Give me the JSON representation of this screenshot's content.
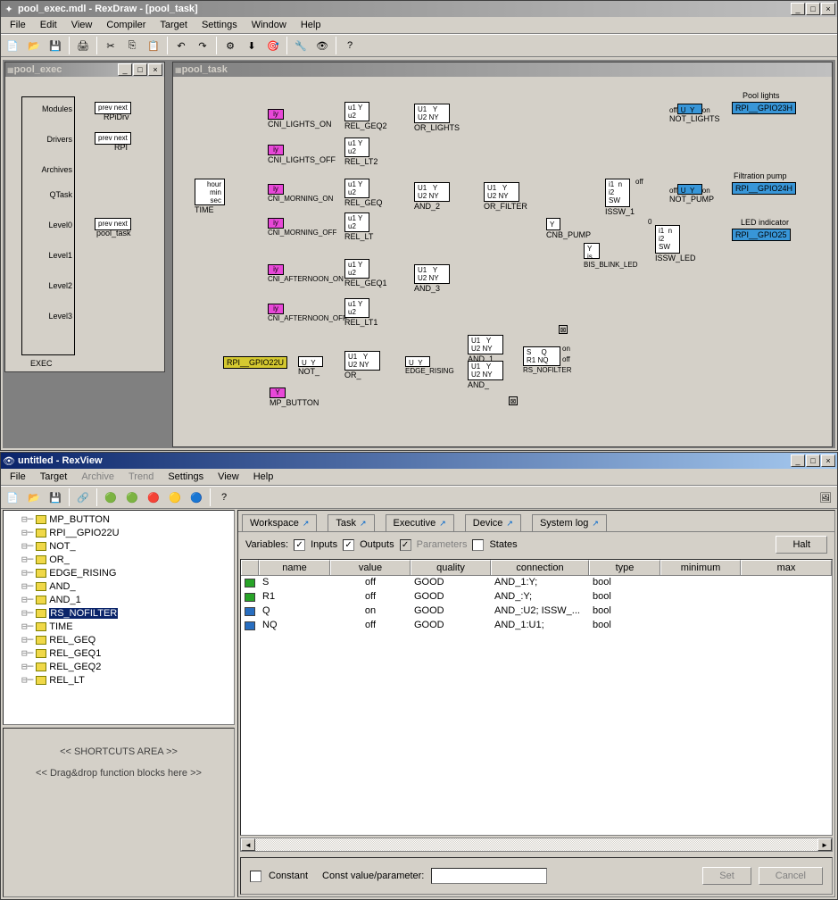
{
  "rexdraw": {
    "titlebar": "pool_exec.mdl - RexDraw - [pool_task]",
    "menu": [
      "File",
      "Edit",
      "View",
      "Compiler",
      "Target",
      "Settings",
      "Window",
      "Help"
    ],
    "child1_title": "pool_exec",
    "child2_title": "pool_task",
    "exec_tree": {
      "modules": "Modules",
      "drivers": "Drivers",
      "archives": "Archives",
      "qtask": "QTask",
      "level0": "Level0",
      "level1": "Level1",
      "level2": "Level2",
      "level3": "Level3",
      "label": "EXEC",
      "prev_next": "prev next",
      "rpidrv": "RPiDrv",
      "rpi": "RPI",
      "pool_task": "pool_task"
    },
    "blocks": {
      "cni_lights_on": "CNI_LIGHTS_ON",
      "cni_lights_off": "CNI_LIGHTS_OFF",
      "cni_morning_on": "CNI_MORNING_ON",
      "cni_morning_off": "CNI_MORNING_OFF",
      "cni_afternoon_on": "CNI_AFTERNOON_ON",
      "cni_afternoon_off": "CNI_AFTERNOON_OFF",
      "time": "TIME",
      "time_ports": "hour\nmin\nsec",
      "rel_geq2": "REL_GEQ2",
      "rel_lt2": "REL_LT2",
      "rel_geq": "REL_GEQ",
      "rel_lt": "REL_LT",
      "rel_geq1": "REL_GEQ1",
      "rel_lt1": "REL_LT1",
      "or_lights": "OR_LIGHTS",
      "and_2": "AND_2",
      "and_3": "AND_3",
      "or_filter": "OR_FILTER",
      "cnb_pump": "CNB_PUMP",
      "issw_1": "ISSW_1",
      "bis_blink_led": "BIS_BLINK_LED",
      "issw_led": "ISSW_LED",
      "not_lights": "NOT_LIGHTS",
      "not_pump": "NOT_PUMP",
      "rpi_gpio23h": "RPI__GPIO23H",
      "rpi_gpio24h": "RPI__GPIO24H",
      "rpi_gpio25": "RPI__GPIO25",
      "rpi_gpio22u": "RPI__GPIO22U",
      "not_": "NOT_",
      "or_": "OR_",
      "mp_button": "MP_BUTTON",
      "edge_rising": "EDGE_RISING",
      "and_1": "AND_1",
      "and_": "AND_",
      "rs_nofilter": "RS_NOFILTER",
      "pool_lights": "Pool lights",
      "filtration_pump": "Filtration pump",
      "led_indicator": "LED indicator",
      "off": "off",
      "on": "on",
      "iy": "iy",
      "y": "Y",
      "u": "U",
      "u1": "u1",
      "u2": "u2",
      "U1": "U1",
      "U2": "U2",
      "NY": "NY",
      "i1": "i1",
      "i2": "i2",
      "SW": "SW",
      "n": "n",
      "is": "is",
      "S": "S",
      "Q": "Q",
      "R1": "R1",
      "NQ": "NQ"
    }
  },
  "rexview": {
    "titlebar": "untitled - RexView",
    "menu": [
      "File",
      "Target",
      "Archive",
      "Trend",
      "Settings",
      "View",
      "Help"
    ],
    "tabs": [
      "Workspace",
      "Task",
      "Executive",
      "Device",
      "System log"
    ],
    "variables_label": "Variables:",
    "inputs_label": "Inputs",
    "outputs_label": "Outputs",
    "parameters_label": "Parameters",
    "states_label": "States",
    "halt_btn": "Halt",
    "columns": [
      "name",
      "value",
      "quality",
      "connection",
      "type",
      "minimum",
      "max"
    ],
    "rows": [
      {
        "icon": "in",
        "name": "S",
        "value": "off",
        "quality": "GOOD",
        "connection": "AND_1:Y;",
        "type": "bool"
      },
      {
        "icon": "in",
        "name": "R1",
        "value": "off",
        "quality": "GOOD",
        "connection": "AND_:Y;",
        "type": "bool"
      },
      {
        "icon": "out",
        "name": "Q",
        "value": "on",
        "quality": "GOOD",
        "connection": "AND_:U2; ISSW_...",
        "type": "bool"
      },
      {
        "icon": "out",
        "name": "NQ",
        "value": "off",
        "quality": "GOOD",
        "connection": "AND_1:U1;",
        "type": "bool"
      }
    ],
    "tree": [
      "MP_BUTTON",
      "RPI__GPIO22U",
      "NOT_",
      "OR_",
      "EDGE_RISING",
      "AND_",
      "AND_1",
      "RS_NOFILTER",
      "TIME",
      "REL_GEQ",
      "REL_GEQ1",
      "REL_GEQ2",
      "REL_LT"
    ],
    "tree_selected": "RS_NOFILTER",
    "shortcuts1": "<< SHORTCUTS AREA >>",
    "shortcuts2": "<< Drag&drop function blocks here >>",
    "constant_label": "Constant",
    "const_value_label": "Const value/parameter:",
    "set_btn": "Set",
    "cancel_btn": "Cancel"
  }
}
